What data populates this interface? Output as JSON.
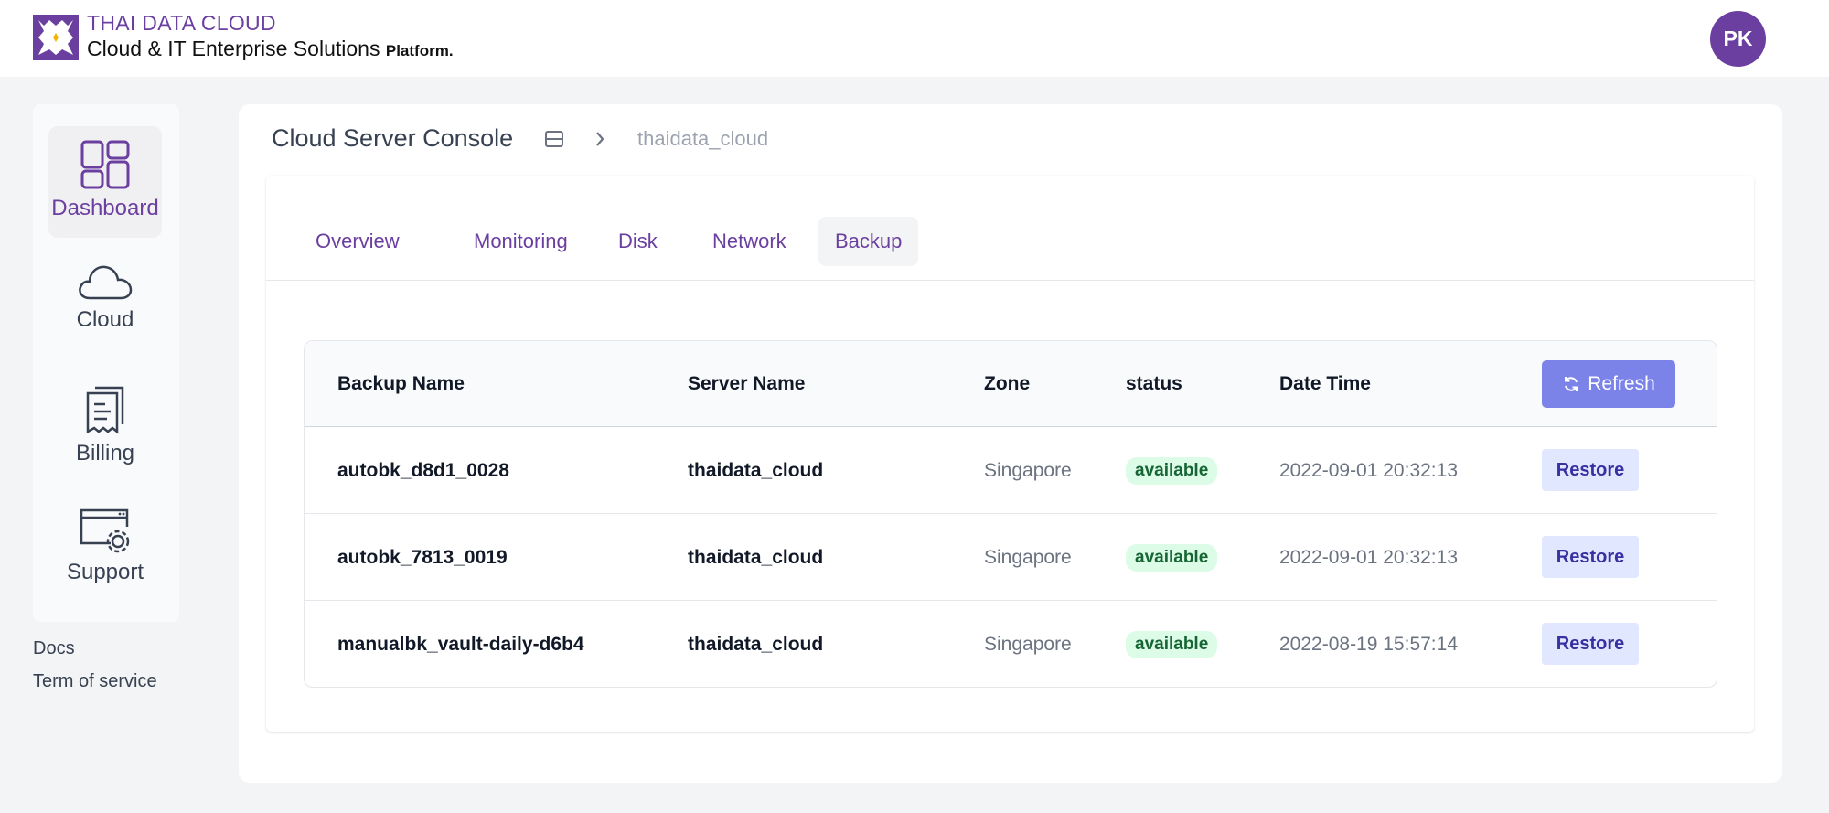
{
  "header": {
    "brand_line1": "THAI DATA CLOUD",
    "brand_line2": "Cloud & IT Enterprise Solutions",
    "brand_line2_suffix": "Platform.",
    "avatar_initials": "PK",
    "accent_color": "#6b3fa0"
  },
  "sidebar": {
    "items": [
      {
        "label": "Dashboard",
        "icon": "dashboard-icon",
        "active": true
      },
      {
        "label": "Cloud",
        "icon": "cloud-icon",
        "active": false
      },
      {
        "label": "Billing",
        "icon": "receipt-icon",
        "active": false
      },
      {
        "label": "Support",
        "icon": "settings-window-icon",
        "active": false
      }
    ],
    "links": [
      "Docs",
      "Term of service"
    ]
  },
  "console": {
    "title": "Cloud Server Console",
    "breadcrumb_server": "thaidata_cloud"
  },
  "tabs": [
    {
      "label": "Overview",
      "active": false
    },
    {
      "label": "Monitoring",
      "active": false
    },
    {
      "label": "Disk",
      "active": false
    },
    {
      "label": "Network",
      "active": false
    },
    {
      "label": "Backup",
      "active": true
    }
  ],
  "table": {
    "columns": [
      "Backup Name",
      "Server Name",
      "Zone",
      "status",
      "Date Time"
    ],
    "refresh_label": "Refresh",
    "restore_label": "Restore",
    "rows": [
      {
        "backup_name": "autobk_d8d1_0028",
        "server_name": "thaidata_cloud",
        "zone": "Singapore",
        "status": "available",
        "date_time": "2022-09-01 20:32:13"
      },
      {
        "backup_name": "autobk_7813_0019",
        "server_name": "thaidata_cloud",
        "zone": "Singapore",
        "status": "available",
        "date_time": "2022-09-01 20:32:13"
      },
      {
        "backup_name": "manualbk_vault-daily-d6b4",
        "server_name": "thaidata_cloud",
        "zone": "Singapore",
        "status": "available",
        "date_time": "2022-08-19 15:57:14"
      }
    ]
  }
}
